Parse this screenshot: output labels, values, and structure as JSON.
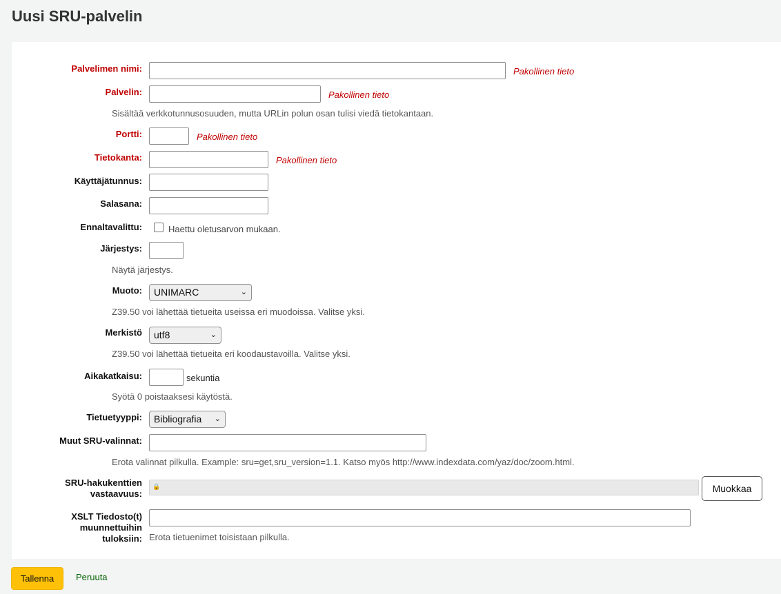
{
  "page": {
    "title": "Uusi SRU-palvelin"
  },
  "form": {
    "required_note": "Pakollinen tieto",
    "name": {
      "label": "Palvelimen nimi:",
      "value": ""
    },
    "host": {
      "label": "Palvelin:",
      "value": "",
      "hint": "Sisältää verkkotunnusosuuden, mutta URLin polun osan tulisi viedä tietokantaan."
    },
    "port": {
      "label": "Portti:",
      "value": ""
    },
    "database": {
      "label": "Tietokanta:",
      "value": ""
    },
    "userid": {
      "label": "Käyttäjätunnus:",
      "value": ""
    },
    "password": {
      "label": "Salasana:",
      "value": ""
    },
    "checked": {
      "label": "Ennaltavalittu:",
      "text": "Haettu oletusarvon mukaan.",
      "checked": false
    },
    "rank": {
      "label": "Järjestys:",
      "value": "",
      "hint": "Näytä järjestys."
    },
    "syntax": {
      "label": "Muoto:",
      "selected": "UNIMARC",
      "hint": "Z39.50 voi lähettää tietueita useissa eri muodoissa. Valitse yksi."
    },
    "encoding": {
      "label": "Merkistö",
      "selected": "utf8",
      "hint": "Z39.50 voi lähettää tietueita eri koodaustavoilla. Valitse yksi."
    },
    "timeout": {
      "label": "Aikakatkaisu:",
      "value": "",
      "unit": "sekuntia",
      "hint": "Syötä 0 poistaaksesi käytöstä."
    },
    "recordtype": {
      "label": "Tietuetyyppi:",
      "selected": "Bibliografia"
    },
    "sru_options": {
      "label": "Muut SRU-valinnat:",
      "value": "",
      "hint": "Erota valinnat pilkulla. Example: sru=get,sru_version=1.1. Katso myös http://www.indexdata.com/yaz/doc/zoom.html."
    },
    "sru_fields": {
      "label_line1": "SRU-hakukenttien",
      "label_line2": "vastaavuus:",
      "value": "",
      "edit_button": "Muokkaa"
    },
    "xslt": {
      "label_line1": "XSLT Tiedosto(t)",
      "label_line2": "muunnettuihin",
      "label_line3": "tuloksiin:",
      "value": "",
      "hint": "Erota tietuenimet toisistaan pilkulla."
    }
  },
  "actions": {
    "save": "Tallenna",
    "cancel": "Peruuta"
  },
  "colors": {
    "required": "#c00000",
    "save_button": "#ffc107",
    "cancel_link": "#006100"
  }
}
